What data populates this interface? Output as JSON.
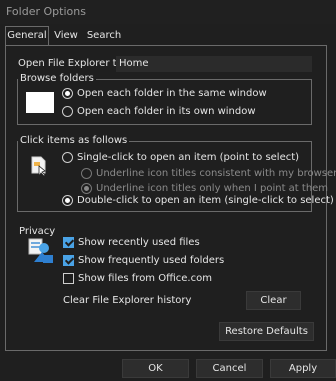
{
  "window": {
    "title": "Folder Options"
  },
  "tabs": [
    {
      "label": "General"
    },
    {
      "label": "View"
    },
    {
      "label": "Search"
    }
  ],
  "general": {
    "open_label": "Open File Explorer to:",
    "open_value": "Home",
    "browse": {
      "title": "Browse folders",
      "opt_same": "Open each folder in the same window",
      "opt_own": "Open each folder in its own window",
      "selected": "same"
    },
    "click": {
      "title": "Click items as follows",
      "opt_single": "Single-click to open an item (point to select)",
      "opt_underline_browser": "Underline icon titles consistent with my browser",
      "opt_underline_point": "Underline icon titles only when I point at them",
      "opt_double": "Double-click to open an item (single-click to select)",
      "selected": "double"
    },
    "privacy": {
      "title": "Privacy",
      "recent_files": "Show recently used files",
      "frequent_folders": "Show frequently used folders",
      "office_files": "Show files from Office.com",
      "recent_files_checked": true,
      "frequent_folders_checked": true,
      "office_files_checked": false,
      "clear_label": "Clear File Explorer history",
      "clear_button": "Clear"
    },
    "restore_button": "Restore Defaults"
  },
  "footer": {
    "ok": "OK",
    "cancel": "Cancel",
    "apply": "Apply"
  }
}
